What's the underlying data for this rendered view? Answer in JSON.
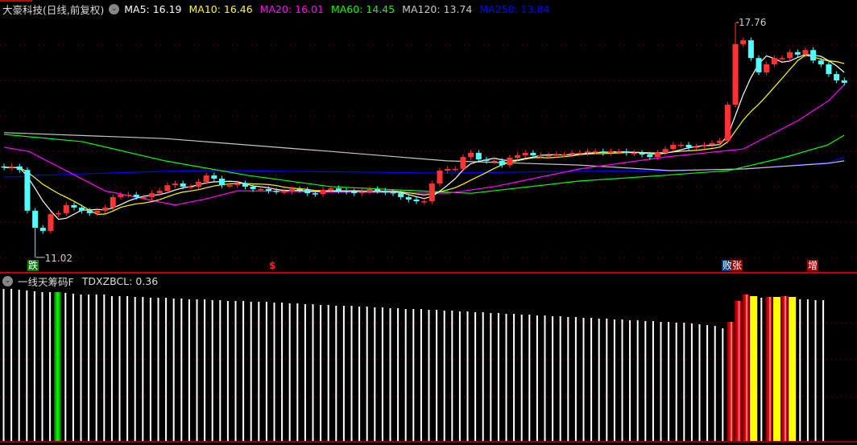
{
  "header": {
    "title": "大豪科技(日线,前复权)",
    "ma": [
      {
        "label": "MA5: 16.19",
        "color": "#ffffff"
      },
      {
        "label": "MA10: 16.46",
        "color": "#ffff00"
      },
      {
        "label": "MA20: 16.01",
        "color": "#ff00ff"
      },
      {
        "label": "MA60: 14.45",
        "color": "#00ff00"
      },
      {
        "label": "MA120: 13.74",
        "color": "#c8c8c8"
      },
      {
        "label": "MA250: 13.84",
        "color": "#0000ff"
      }
    ]
  },
  "price": {
    "high_label": "17.76",
    "low_label": "11.02",
    "high": 17.76,
    "low": 11.02,
    "high_index": 94,
    "low_index": 4,
    "closes": [
      13.6,
      13.63,
      13.53,
      12.36,
      11.87,
      11.78,
      12.26,
      12.29,
      12.52,
      12.45,
      12.36,
      12.29,
      12.36,
      12.45,
      12.75,
      12.82,
      12.82,
      12.75,
      12.75,
      12.86,
      12.93,
      13.09,
      13.14,
      13.05,
      13.05,
      13.19,
      13.37,
      13.28,
      13.09,
      13.09,
      13.14,
      13.05,
      12.98,
      12.98,
      12.93,
      12.91,
      12.91,
      12.98,
      12.96,
      12.86,
      12.84,
      12.96,
      13.0,
      12.93,
      12.91,
      12.86,
      12.91,
      12.98,
      12.93,
      12.89,
      12.86,
      12.75,
      12.68,
      12.63,
      12.63,
      13.14,
      13.51,
      13.56,
      13.56,
      13.9,
      14.02,
      13.83,
      13.79,
      13.79,
      13.67,
      13.88,
      13.95,
      14.02,
      13.95,
      13.95,
      13.95,
      13.97,
      13.97,
      14.02,
      14.02,
      14.06,
      14.06,
      14.02,
      14.06,
      14.06,
      14.02,
      14.02,
      13.97,
      13.9,
      14.02,
      14.13,
      14.25,
      14.25,
      14.18,
      14.2,
      14.25,
      14.3,
      14.37,
      15.4,
      17.14,
      17.25,
      16.74,
      16.33,
      16.56,
      16.74,
      16.74,
      16.91,
      16.84,
      16.97,
      16.67,
      16.56,
      16.28,
      16.1,
      16.03
    ],
    "ma20": [
      [
        0,
        14.18
      ],
      [
        3.2,
        14.06
      ],
      [
        13,
        12.93
      ],
      [
        22,
        12.52
      ],
      [
        26,
        12.7
      ],
      [
        30,
        12.93
      ],
      [
        57,
        12.86
      ],
      [
        63,
        13.05
      ],
      [
        74,
        13.56
      ],
      [
        85,
        13.9
      ],
      [
        95,
        14.13
      ],
      [
        102,
        14.94
      ],
      [
        106,
        15.52
      ],
      [
        108,
        15.98
      ]
    ],
    "ma60": [
      [
        0,
        14.55
      ],
      [
        10.1,
        14.34
      ],
      [
        20.7,
        13.79
      ],
      [
        31.4,
        13.37
      ],
      [
        42,
        13.05
      ],
      [
        56.9,
        12.89
      ],
      [
        60.1,
        12.86
      ],
      [
        73.9,
        13.21
      ],
      [
        84.6,
        13.37
      ],
      [
        93.1,
        13.51
      ],
      [
        100.5,
        13.9
      ],
      [
        105.9,
        14.25
      ],
      [
        108,
        14.53
      ]
    ],
    "ma120": [
      [
        0,
        14.6
      ],
      [
        20.7,
        14.43
      ],
      [
        42,
        14.06
      ],
      [
        56.9,
        13.79
      ],
      [
        73.9,
        13.67
      ],
      [
        85.6,
        13.51
      ],
      [
        95.2,
        13.56
      ],
      [
        105.9,
        13.72
      ],
      [
        108,
        13.79
      ]
    ],
    "ma250": [
      [
        0,
        13.33
      ],
      [
        1.6,
        13.33
      ],
      [
        3.7,
        13.37
      ],
      [
        20.7,
        13.49
      ],
      [
        28.2,
        13.51
      ],
      [
        56.9,
        13.44
      ],
      [
        73.9,
        13.49
      ],
      [
        86.7,
        13.51
      ],
      [
        95.2,
        13.56
      ],
      [
        105.9,
        13.74
      ],
      [
        108,
        13.9
      ]
    ],
    "colors": {
      "up": "#ff3333",
      "down": "#54ffff"
    }
  },
  "markers": [
    {
      "text": "跌",
      "bg": "#008000",
      "color": "#ffffff"
    },
    {
      "text": "$",
      "bg": "transparent",
      "color": "#ff2020"
    },
    {
      "text": "败",
      "bg": "#004080",
      "color": "#ffffff"
    },
    {
      "text": "张",
      "bg": "#a00000",
      "color": "#ffffff"
    },
    {
      "text": "增",
      "bg": "#a00000",
      "color": "#ffffff"
    }
  ],
  "indicator": {
    "title": "一线天筹码F",
    "value_label": "TDXZBCL: 0.36",
    "bars": [
      [
        "w",
        189
      ],
      [
        "w",
        189
      ],
      [
        "w",
        188
      ],
      [
        "w",
        187
      ],
      [
        "w",
        186
      ],
      [
        "w",
        185
      ],
      [
        "w",
        185
      ],
      [
        "g",
        185
      ],
      [
        "w",
        184
      ],
      [
        "w",
        183
      ],
      [
        "w",
        182
      ],
      [
        "w",
        182
      ],
      [
        "w",
        182
      ],
      [
        "w",
        182
      ],
      [
        "w",
        180
      ],
      [
        "w",
        180
      ],
      [
        "w",
        180
      ],
      [
        "w",
        179
      ],
      [
        "w",
        179
      ],
      [
        "w",
        178
      ],
      [
        "w",
        178
      ],
      [
        "w",
        178
      ],
      [
        "w",
        177
      ],
      [
        "w",
        177
      ],
      [
        "w",
        176
      ],
      [
        "w",
        176
      ],
      [
        "w",
        176
      ],
      [
        "w",
        175
      ],
      [
        "w",
        175
      ],
      [
        "w",
        174
      ],
      [
        "w",
        174
      ],
      [
        "w",
        174
      ],
      [
        "w",
        173
      ],
      [
        "w",
        173
      ],
      [
        "w",
        173
      ],
      [
        "w",
        172
      ],
      [
        "w",
        172
      ],
      [
        "w",
        171
      ],
      [
        "w",
        171
      ],
      [
        "w",
        170
      ],
      [
        "w",
        170
      ],
      [
        "w",
        169
      ],
      [
        "w",
        169
      ],
      [
        "w",
        168
      ],
      [
        "w",
        168
      ],
      [
        "w",
        168
      ],
      [
        "w",
        167
      ],
      [
        "w",
        167
      ],
      [
        "w",
        166
      ],
      [
        "w",
        166
      ],
      [
        "w",
        165
      ],
      [
        "w",
        165
      ],
      [
        "w",
        164
      ],
      [
        "w",
        164
      ],
      [
        "w",
        164
      ],
      [
        "w",
        163
      ],
      [
        "w",
        163
      ],
      [
        "w",
        162
      ],
      [
        "w",
        162
      ],
      [
        "w",
        161
      ],
      [
        "w",
        161
      ],
      [
        "w",
        160
      ],
      [
        "w",
        160
      ],
      [
        "w",
        159
      ],
      [
        "w",
        159
      ],
      [
        "w",
        158
      ],
      [
        "w",
        158
      ],
      [
        "w",
        157
      ],
      [
        "w",
        157
      ],
      [
        "w",
        156
      ],
      [
        "w",
        156
      ],
      [
        "w",
        155
      ],
      [
        "w",
        155
      ],
      [
        "w",
        154
      ],
      [
        "w",
        154
      ],
      [
        "w",
        153
      ],
      [
        "w",
        153
      ],
      [
        "w",
        152
      ],
      [
        "w",
        152
      ],
      [
        "w",
        151
      ],
      [
        "w",
        151
      ],
      [
        "w",
        150
      ],
      [
        "w",
        150
      ],
      [
        "w",
        149
      ],
      [
        "w",
        149
      ],
      [
        "w",
        148
      ],
      [
        "w",
        148
      ],
      [
        "w",
        147
      ],
      [
        "w",
        147
      ],
      [
        "w",
        146
      ],
      [
        "w",
        145
      ],
      [
        "w",
        144
      ],
      [
        "w",
        143
      ],
      [
        "w",
        140
      ],
      [
        "r",
        148
      ],
      [
        "r",
        174
      ],
      [
        "r",
        182
      ],
      [
        "y",
        180
      ],
      [
        "w",
        178
      ],
      [
        "r",
        179
      ],
      [
        "y",
        179
      ],
      [
        "r",
        180
      ],
      [
        "y",
        179
      ],
      [
        "w",
        176
      ],
      [
        "w",
        176
      ],
      [
        "w",
        175
      ],
      [
        "w",
        175
      ]
    ]
  }
}
